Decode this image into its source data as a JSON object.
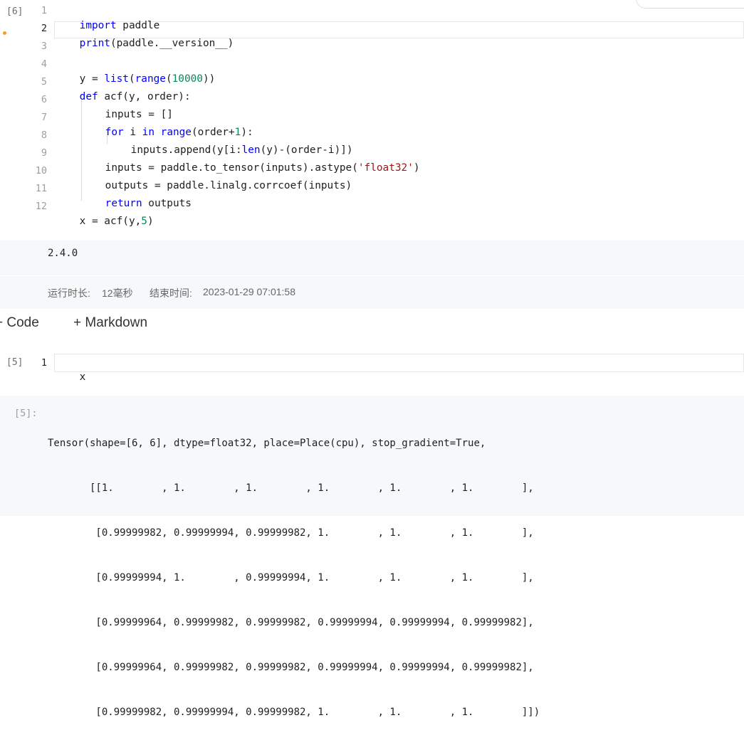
{
  "cell1": {
    "exec_count": "[6]",
    "lines": [
      {
        "n": "1"
      },
      {
        "n": "2"
      },
      {
        "n": "3"
      },
      {
        "n": "4"
      },
      {
        "n": "5"
      },
      {
        "n": "6"
      },
      {
        "n": "7"
      },
      {
        "n": "8"
      },
      {
        "n": "9"
      },
      {
        "n": "10"
      },
      {
        "n": "11"
      },
      {
        "n": "12"
      }
    ],
    "code": {
      "l1_kw": "import",
      "l1_rest": " paddle",
      "l2_fn": "print",
      "l2_rest": "(paddle.__version__)",
      "l4_a": "y = ",
      "l4_list": "list",
      "l4_b": "(",
      "l4_range": "range",
      "l4_c": "(",
      "l4_num": "10000",
      "l4_d": "))",
      "l5_kw": "def",
      "l5_rest": " acf(y, order):",
      "l6": "inputs = []",
      "l7_for": "for",
      "l7_a": " i ",
      "l7_in": "in",
      "l7_b": " ",
      "l7_range": "range",
      "l7_c": "(order+",
      "l7_num": "1",
      "l7_d": "):",
      "l8_a": "inputs.append(y[i:",
      "l8_len": "len",
      "l8_b": "(y)-(order-i)])",
      "l9_a": "inputs = paddle.to_tensor(inputs).astype(",
      "l9_str": "'float32'",
      "l9_b": ")",
      "l10": "outputs = paddle.linalg.corrcoef(inputs)",
      "l11_kw": "return",
      "l11_rest": " outputs",
      "l12_a": "x = acf(y,",
      "l12_num": "5",
      "l12_b": ")"
    },
    "output": "2.4.0",
    "runtime_label": "运行时长:",
    "runtime_value": "12毫秒",
    "end_label": "结束时间:",
    "end_value": "2023-01-29 07:01:58"
  },
  "toolbar": {
    "add_code": "+ Code",
    "add_markdown": "+ Markdown"
  },
  "cell2": {
    "exec_count": "[5]",
    "line_no": "1",
    "code": "x",
    "out_prompt": "[5]:",
    "output_lines": [
      "Tensor(shape=[6, 6], dtype=float32, place=Place(cpu), stop_gradient=True,",
      "       [[1.        , 1.        , 1.        , 1.        , 1.        , 1.        ],",
      "        [0.99999982, 0.99999994, 0.99999982, 1.        , 1.        , 1.        ],",
      "        [0.99999994, 1.        , 0.99999994, 1.        , 1.        , 1.        ],",
      "        [0.99999964, 0.99999982, 0.99999982, 0.99999994, 0.99999994, 0.99999982],",
      "        [0.99999964, 0.99999982, 0.99999982, 0.99999994, 0.99999994, 0.99999982],",
      "        [0.99999982, 0.99999994, 0.99999982, 1.        , 1.        , 1.        ]])"
    ]
  },
  "colors": {
    "keyword": "#0000ff",
    "number": "#098658",
    "string": "#a31515",
    "modified_dot": "#f0a020"
  }
}
